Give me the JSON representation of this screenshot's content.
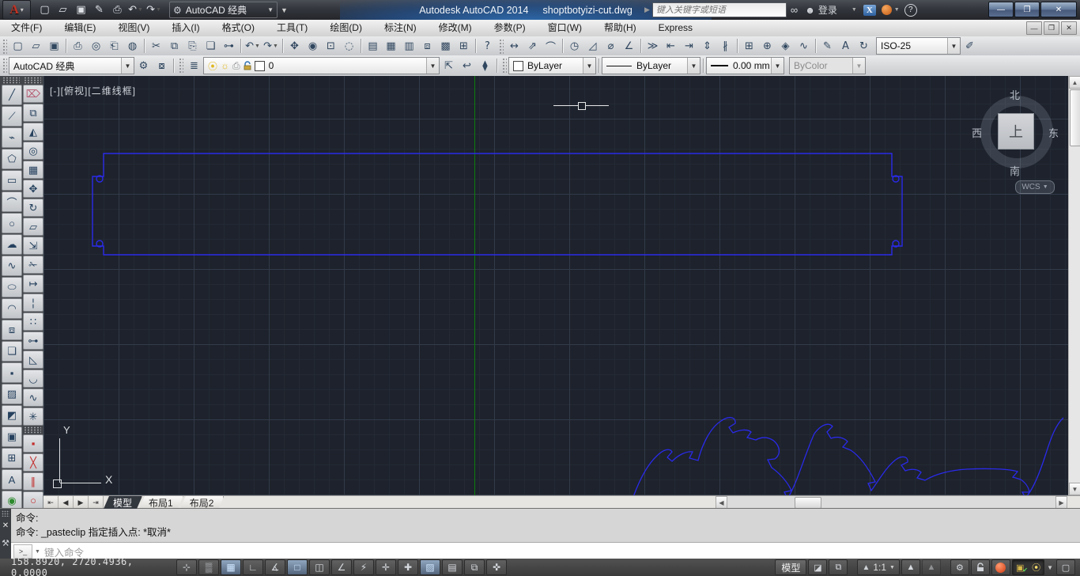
{
  "window": {
    "app_title": "Autodesk AutoCAD 2014",
    "doc_title": "shoptbotyizi-cut.dwg",
    "search_placeholder": "键入关键字或短语",
    "signin_label": "登录",
    "workspace": "AutoCAD 经典"
  },
  "menus": [
    {
      "key": "file",
      "label": "文件(F)"
    },
    {
      "key": "edit",
      "label": "编辑(E)"
    },
    {
      "key": "view",
      "label": "视图(V)"
    },
    {
      "key": "insert",
      "label": "插入(I)"
    },
    {
      "key": "format",
      "label": "格式(O)"
    },
    {
      "key": "tools",
      "label": "工具(T)"
    },
    {
      "key": "draw",
      "label": "绘图(D)"
    },
    {
      "key": "dimension",
      "label": "标注(N)"
    },
    {
      "key": "modify",
      "label": "修改(M)"
    },
    {
      "key": "parametric",
      "label": "参数(P)"
    },
    {
      "key": "window",
      "label": "窗口(W)"
    },
    {
      "key": "help",
      "label": "帮助(H)"
    },
    {
      "key": "express",
      "label": "Express"
    }
  ],
  "quick_access": {
    "icons": [
      {
        "n": "new-file",
        "g": "▢"
      },
      {
        "n": "open-file",
        "g": "▱"
      },
      {
        "n": "save",
        "g": "▣"
      },
      {
        "n": "save-as",
        "g": "✎"
      },
      {
        "n": "plot",
        "g": "⎙"
      },
      {
        "n": "undo",
        "g": "↶",
        "dd": true
      },
      {
        "n": "redo",
        "g": "↷",
        "dd": true
      }
    ]
  },
  "standard_toolbar": [
    {
      "n": "new-file",
      "g": "▢"
    },
    {
      "n": "open-file",
      "g": "▱"
    },
    {
      "n": "save",
      "g": "▣"
    },
    {
      "sep": true
    },
    {
      "n": "plot",
      "g": "⎙"
    },
    {
      "n": "plot-preview",
      "g": "◎"
    },
    {
      "n": "publish",
      "g": "⎗"
    },
    {
      "n": "3d-dwf",
      "g": "◍"
    },
    {
      "sep": true
    },
    {
      "n": "cut-clip",
      "g": "✂"
    },
    {
      "n": "copy-clip",
      "g": "⧉"
    },
    {
      "n": "paste-clip",
      "g": "⎘"
    },
    {
      "n": "paste-block",
      "g": "❏"
    },
    {
      "n": "match-properties",
      "g": "⊶"
    },
    {
      "sep": true
    },
    {
      "n": "undo",
      "g": "↶",
      "dd": true
    },
    {
      "n": "redo",
      "g": "↷",
      "dd": true
    },
    {
      "sep": true
    },
    {
      "n": "pan-realtime",
      "g": "✥"
    },
    {
      "n": "zoom-realtime",
      "g": "◉"
    },
    {
      "n": "zoom-window",
      "g": "⊡"
    },
    {
      "n": "zoom-previous",
      "g": "◌"
    },
    {
      "sep": true
    },
    {
      "n": "properties-palette",
      "g": "▤"
    },
    {
      "n": "designcenter",
      "g": "▦"
    },
    {
      "n": "tool-palettes",
      "g": "▥"
    },
    {
      "n": "sheet-set-manager",
      "g": "⧈"
    },
    {
      "n": "markup-set-manager",
      "g": "▩"
    },
    {
      "n": "quickcalc",
      "g": "⊞"
    },
    {
      "sep": true
    },
    {
      "n": "help",
      "g": "?"
    }
  ],
  "dimension_toolbar": {
    "icons": [
      {
        "n": "dim-linear",
        "g": "↔"
      },
      {
        "n": "dim-aligned",
        "g": "⇗"
      },
      {
        "n": "dim-arc-length",
        "g": "⌒"
      },
      {
        "sep": true
      },
      {
        "n": "dim-radius",
        "g": "◷"
      },
      {
        "n": "dim-jogged",
        "g": "◿"
      },
      {
        "n": "dim-diameter",
        "g": "⌀"
      },
      {
        "n": "dim-angular",
        "g": "∠"
      },
      {
        "sep": true
      },
      {
        "n": "quick-dimension",
        "g": "≫"
      },
      {
        "n": "dim-baseline",
        "g": "⇤"
      },
      {
        "n": "dim-continue",
        "g": "⇥"
      },
      {
        "n": "dim-space",
        "g": "⇕"
      },
      {
        "n": "dim-break",
        "g": "∦"
      },
      {
        "sep": true
      },
      {
        "n": "tolerance",
        "g": "⊞"
      },
      {
        "n": "center-mark",
        "g": "⊕"
      },
      {
        "n": "dim-inspect",
        "g": "◈"
      },
      {
        "n": "dim-jogged-linear",
        "g": "∿"
      },
      {
        "sep": true
      },
      {
        "n": "dim-edit",
        "g": "✎"
      },
      {
        "n": "dim-text-edit",
        "g": "A"
      },
      {
        "n": "dim-update",
        "g": "↻"
      }
    ],
    "style_value": "ISO-25",
    "style_button": {
      "n": "dim-style",
      "g": "✐"
    }
  },
  "workspaces_toolbar": {
    "value": "AutoCAD 经典",
    "icons": [
      {
        "n": "workspace-settings",
        "g": "⚙"
      },
      {
        "n": "save-workspace",
        "g": "⧇"
      }
    ]
  },
  "layers_toolbar": {
    "manager": {
      "n": "layer-properties-manager",
      "g": "≣"
    },
    "combo": {
      "layer_name": "0",
      "bulb": "⦿",
      "sun": "☼",
      "plot": "⎙"
    },
    "tools": [
      {
        "n": "make-object-layer-current",
        "g": "⇱"
      },
      {
        "n": "layer-previous",
        "g": "↩"
      },
      {
        "n": "layer-states",
        "g": "⧫"
      }
    ]
  },
  "properties_toolbar": {
    "color_value": "ByLayer",
    "linetype_value": "ByLayer",
    "lineweight_value": "0.00 mm",
    "plotstyle_value": "ByColor"
  },
  "draw_toolbar": [
    {
      "n": "line",
      "g": "╱"
    },
    {
      "n": "construction-line",
      "g": "⟋"
    },
    {
      "n": "polyline",
      "g": "⌁"
    },
    {
      "n": "polygon",
      "g": "⬠"
    },
    {
      "n": "rectangle",
      "g": "▭"
    },
    {
      "n": "arc",
      "g": "⌒"
    },
    {
      "n": "circle",
      "g": "○"
    },
    {
      "n": "revision-cloud",
      "g": "☁"
    },
    {
      "n": "spline",
      "g": "∿"
    },
    {
      "n": "ellipse",
      "g": "⬭"
    },
    {
      "n": "ellipse-arc",
      "g": "◠"
    },
    {
      "n": "insert-block",
      "g": "⧈"
    },
    {
      "n": "make-block",
      "g": "❏"
    },
    {
      "n": "point",
      "g": "▪"
    },
    {
      "n": "hatch",
      "g": "▨"
    },
    {
      "n": "gradient",
      "g": "◩"
    },
    {
      "n": "region",
      "g": "▣"
    },
    {
      "n": "table",
      "g": "⊞"
    },
    {
      "n": "multiline-text",
      "g": "A"
    },
    {
      "n": "add-selected",
      "g": "◉",
      "c": "#2c8a2c"
    }
  ],
  "modify_toolbar": [
    {
      "n": "erase",
      "g": "⌦",
      "c": "#b4566e"
    },
    {
      "n": "copy",
      "g": "⧉"
    },
    {
      "n": "mirror",
      "g": "◭"
    },
    {
      "n": "offset",
      "g": "◎"
    },
    {
      "n": "array",
      "g": "▦"
    },
    {
      "n": "move",
      "g": "✥"
    },
    {
      "n": "rotate",
      "g": "↻"
    },
    {
      "n": "scale",
      "g": "▱"
    },
    {
      "n": "stretch",
      "g": "⇲"
    },
    {
      "n": "trim",
      "g": "✁"
    },
    {
      "n": "extend",
      "g": "↦"
    },
    {
      "n": "break-at-point",
      "g": "¦"
    },
    {
      "n": "break",
      "g": "∷"
    },
    {
      "n": "join",
      "g": "⊶"
    },
    {
      "n": "chamfer",
      "g": "◺"
    },
    {
      "n": "fillet",
      "g": "◡"
    },
    {
      "n": "blend-curves",
      "g": "∿"
    },
    {
      "n": "explode",
      "g": "✳"
    }
  ],
  "osnap_toolbar": [
    {
      "n": "snap-endpoint",
      "g": "▪"
    },
    {
      "n": "snap-intersection",
      "g": "╳"
    },
    {
      "n": "snap-parallel",
      "g": "∥"
    },
    {
      "n": "snap-tangent",
      "g": "○"
    },
    {
      "n": "snap-perpendicular",
      "g": "⊥"
    },
    {
      "n": "snap-extension",
      "g": "┆"
    }
  ],
  "canvas": {
    "viewport_label": "[-][俯视][二维线框]",
    "ucs_x": "X",
    "ucs_y": "Y",
    "entity_color": "#2a2ae8",
    "axis_color": "#0c7e0c",
    "entities": [
      "notched-panel-outline",
      "puzzle-joint-profile"
    ]
  },
  "viewcube": {
    "north": "北",
    "west": "西",
    "east": "东",
    "south": "南",
    "face": "上",
    "wcs_label": "WCS"
  },
  "layout_tabs": [
    {
      "key": "model",
      "label": "模型",
      "active": true
    },
    {
      "key": "layout1",
      "label": "布局1",
      "active": false
    },
    {
      "key": "layout2",
      "label": "布局2",
      "active": false
    }
  ],
  "command_window": {
    "lines": [
      "命令:",
      "命令: _pasteclip 指定插入点: *取消*"
    ],
    "input_placeholder": "键入命令"
  },
  "status_bar": {
    "coords": "158.8920, 2720.4936, 0.0000",
    "toggles": [
      {
        "n": "infer-constraints",
        "g": "⊹",
        "on": false
      },
      {
        "n": "snap-mode",
        "g": "▒",
        "on": false
      },
      {
        "n": "grid-display",
        "g": "▦",
        "on": true
      },
      {
        "n": "ortho-mode",
        "g": "∟",
        "on": false
      },
      {
        "n": "polar-tracking",
        "g": "∡",
        "on": false
      },
      {
        "n": "object-snap",
        "g": "□",
        "on": true
      },
      {
        "n": "3d-object-snap",
        "g": "◫",
        "on": false
      },
      {
        "n": "object-snap-tracking",
        "g": "∠",
        "on": false
      },
      {
        "n": "dynamic-ucs",
        "g": "⚡",
        "on": false
      },
      {
        "n": "dynamic-input",
        "g": "✛",
        "on": false
      },
      {
        "n": "lineweight-display",
        "g": "✚",
        "on": false
      },
      {
        "n": "transparency",
        "g": "▨",
        "on": true
      },
      {
        "n": "quick-properties",
        "g": "▤",
        "on": false
      },
      {
        "n": "selection-cycling",
        "g": "⧉",
        "on": false
      },
      {
        "n": "annotation-monitor",
        "g": "✜",
        "on": false
      }
    ],
    "model_label": "模型",
    "annotation_scale": "1:1"
  }
}
